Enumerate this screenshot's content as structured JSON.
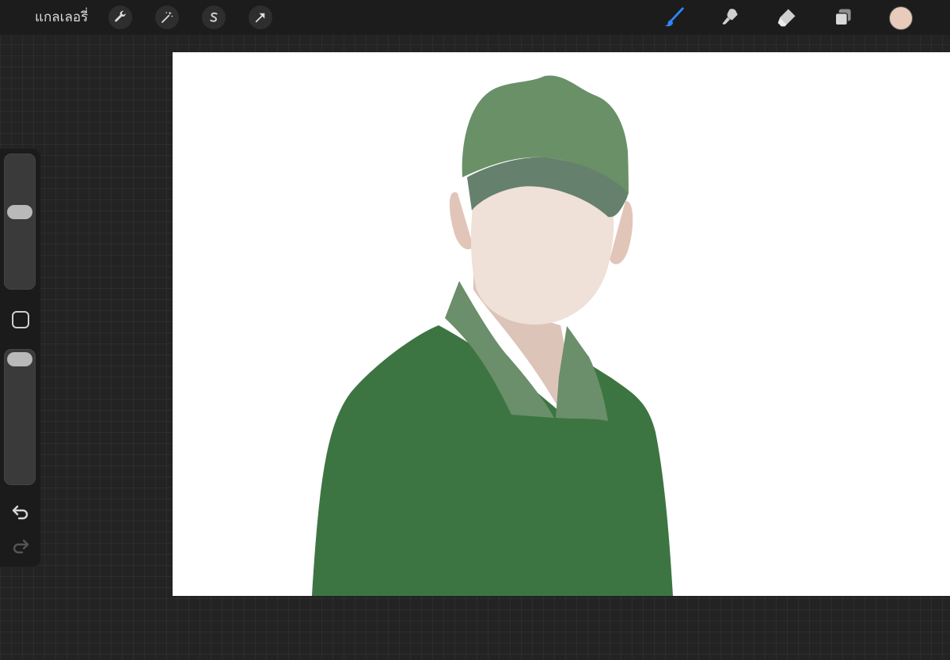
{
  "topbar": {
    "gallery_label": "แกลเลอรี่",
    "left_tools": [
      "wrench-icon",
      "magic-wand-icon",
      "selection-s-icon",
      "transform-arrow-icon"
    ],
    "right_tools": [
      "brush-icon",
      "smudge-icon",
      "eraser-icon",
      "layers-icon"
    ],
    "active_tool": "brush-icon",
    "active_color": "#2f86f5",
    "current_color": "#e8cbbb"
  },
  "sidebar": {
    "brush_size": 0.58,
    "opacity": 1.0,
    "controls": [
      "brush-size-slider",
      "modify-square",
      "opacity-slider",
      "undo-icon",
      "redo-icon"
    ]
  },
  "artwork": {
    "colors": {
      "cap": "#6a9068",
      "cap_brim": "#66806e",
      "skin": "#efe0d8",
      "neck": "#dcc4b8",
      "ears": "#e2c5b9",
      "shirt": "#3d7542",
      "collar": "#6a8f6a"
    }
  }
}
